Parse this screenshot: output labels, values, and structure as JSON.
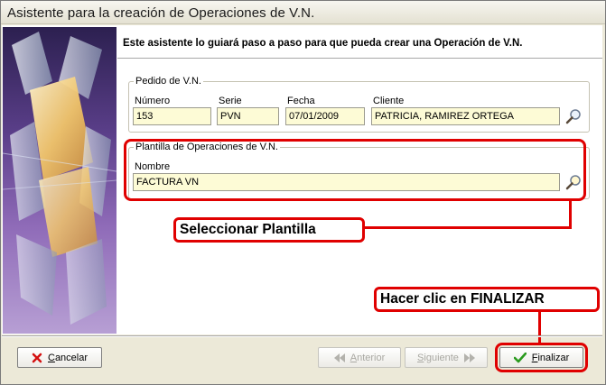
{
  "window": {
    "title": "Asistente para la creación de Operaciones de V.N."
  },
  "intro": "Este asistente lo guiará paso a paso para que pueda crear una Operación de V.N.",
  "pedido": {
    "legend": "Pedido de V.N.",
    "numero": {
      "label": "Número",
      "value": "153"
    },
    "serie": {
      "label": "Serie",
      "value": "PVN"
    },
    "fecha": {
      "label": "Fecha",
      "value": "07/01/2009"
    },
    "cliente": {
      "label": "Cliente",
      "value": "PATRICIA, RAMIREZ ORTEGA"
    }
  },
  "plantilla": {
    "legend": "Plantilla de Operaciones de V.N.",
    "nombre": {
      "label": "Nombre",
      "value": "FACTURA VN"
    }
  },
  "annotations": {
    "select_template": "Seleccionar Plantilla",
    "click_finish": "Hacer clic en FINALIZAR",
    "color": "#e00000"
  },
  "buttons": {
    "cancel": {
      "first": "C",
      "rest": "ancelar",
      "icon": "x-icon"
    },
    "previous": {
      "first": "A",
      "rest": "nterior",
      "icon": "previous-icon"
    },
    "next": {
      "first": "S",
      "rest": "iguiente",
      "icon": "next-icon"
    },
    "finish": {
      "first": "F",
      "rest": "inalizar",
      "icon": "checkmark-icon"
    }
  }
}
